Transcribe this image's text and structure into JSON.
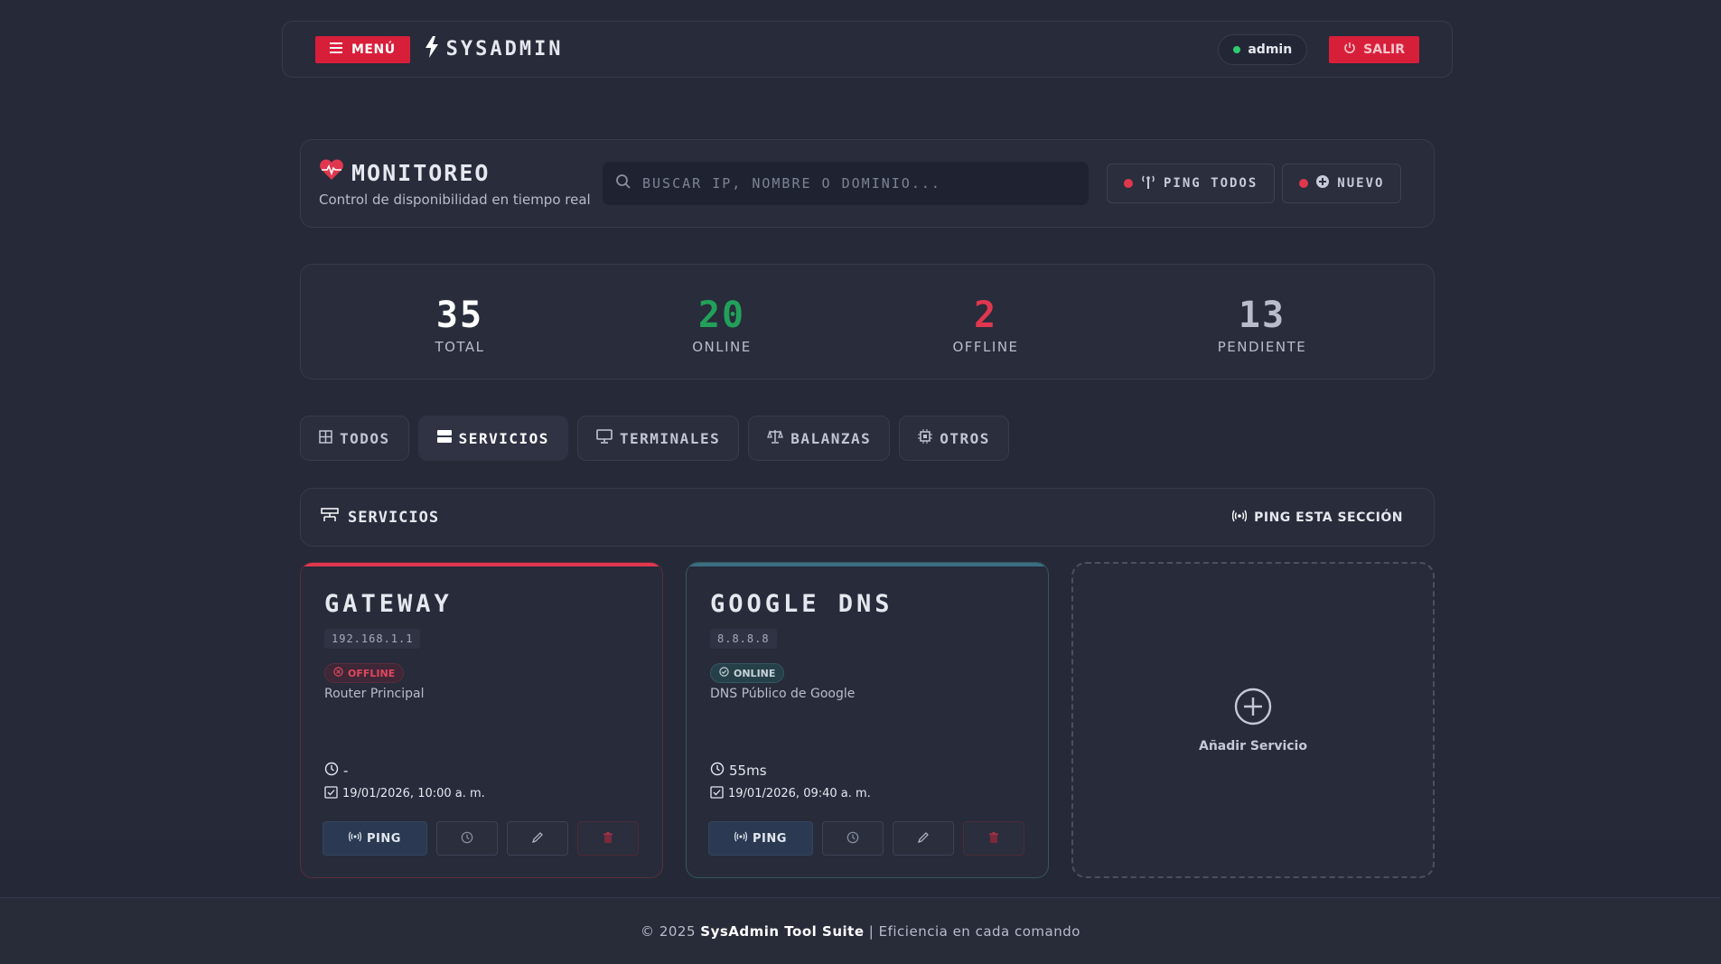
{
  "navbar": {
    "menu_label": "MENÚ",
    "brand": "SYSADMIN",
    "user": "admin",
    "logout_label": "SALIR",
    "user_status_color": "#2ecc71"
  },
  "monitor": {
    "title": "MONITOREO",
    "subtitle": "Control de disponibilidad en tiempo real",
    "search_placeholder": "BUSCAR IP, NOMBRE O DOMINIO...",
    "ping_all_label": "PING TODOS",
    "new_label": "NUEVO"
  },
  "stats": [
    {
      "value": "35",
      "label": "TOTAL",
      "color": "#ffffff"
    },
    {
      "value": "20",
      "label": "ONLINE",
      "color": "#22a05a"
    },
    {
      "value": "2",
      "label": "OFFLINE",
      "color": "#e0374f"
    },
    {
      "value": "13",
      "label": "PENDIENTE",
      "color": "#b8bccb"
    }
  ],
  "tabs": [
    {
      "label": "TODOS",
      "active": false
    },
    {
      "label": "SERVICIOS",
      "active": true
    },
    {
      "label": "TERMINALES",
      "active": false
    },
    {
      "label": "BALANZAS",
      "active": false
    },
    {
      "label": "OTROS",
      "active": false
    }
  ],
  "section": {
    "title": "SERVICIOS",
    "ping_section_label": "PING ESTA SECCIÓN"
  },
  "cards": [
    {
      "name": "GATEWAY",
      "ip": "192.168.1.1",
      "status": "OFFLINE",
      "description": "Router Principal",
      "latency": "-",
      "date": "19/01/2026, 10:00 a. m.",
      "ping_label": "PING",
      "accent": "#e0374f"
    },
    {
      "name": "GOOGLE DNS",
      "ip": "8.8.8.8",
      "status": "ONLINE",
      "description": "DNS Público de Google",
      "latency": "55ms",
      "date": "19/01/2026, 09:40 a. m.",
      "ping_label": "PING",
      "accent": "#3a6f80"
    }
  ],
  "add_card": {
    "label": "Añadir Servicio"
  },
  "footer": {
    "prefix": "© 2025",
    "brand": "SysAdmin Tool Suite",
    "separator": "|",
    "tagline": "Eficiencia en cada comando"
  },
  "colors": {
    "accent_red": "#d81f3a",
    "background": "#262a38"
  }
}
